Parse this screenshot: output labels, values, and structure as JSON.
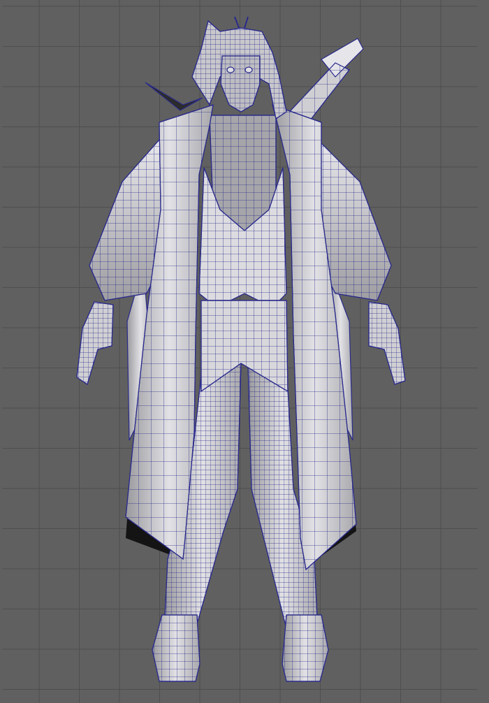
{
  "viewport": {
    "background_color": "#606060",
    "grid_color": "#4e4e4e",
    "mesh_wire_color": "#2a2a8c",
    "mesh_surface_color": "#d4d4d8",
    "mesh_shadow_color": "#1a1a1a"
  },
  "model": {
    "icon": "character-wireframe-model"
  }
}
